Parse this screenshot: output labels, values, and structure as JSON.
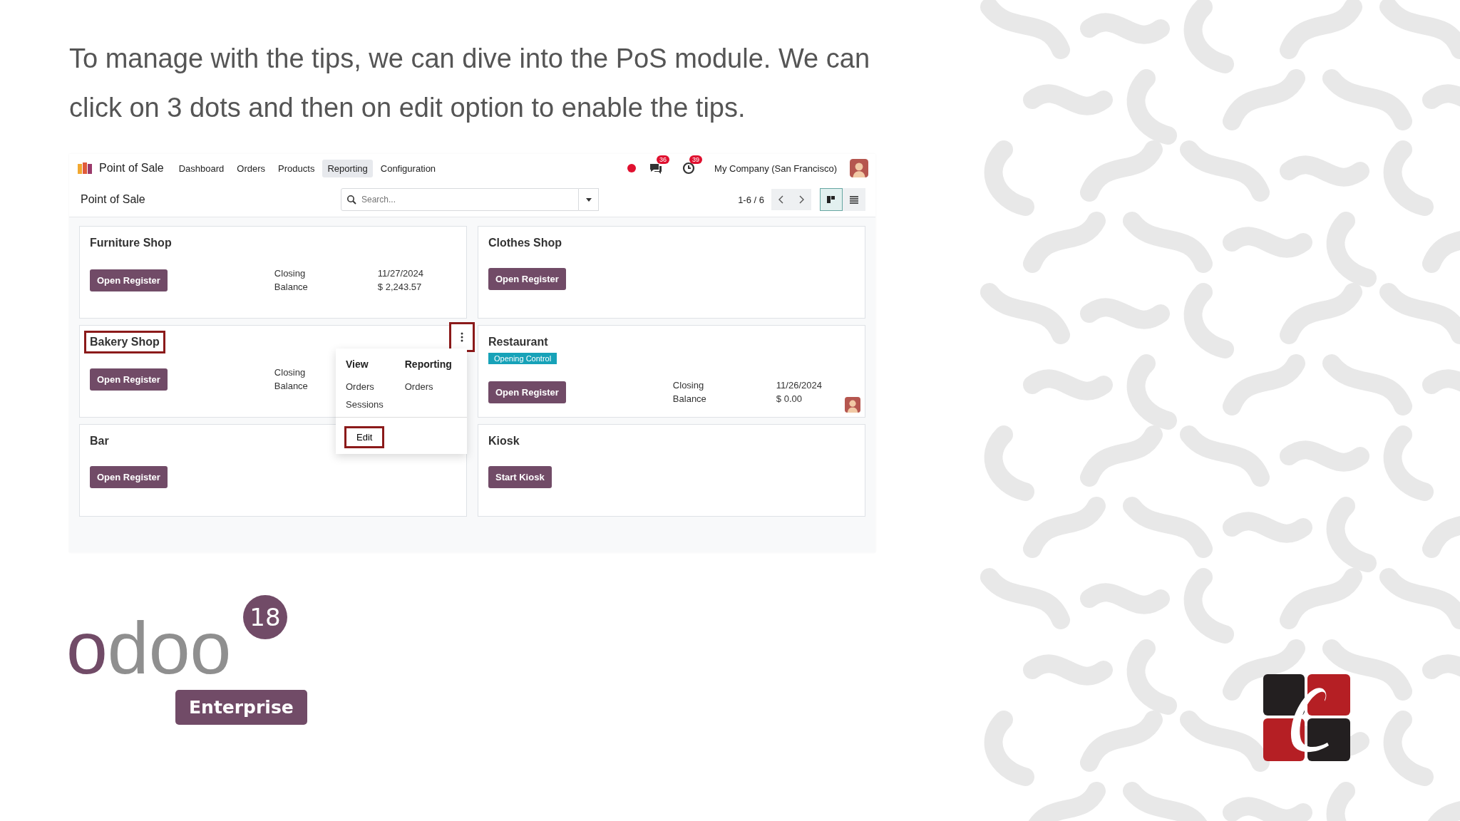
{
  "slide_text": "To manage with the tips, we can dive into the PoS module. We can click on 3 dots and then on edit option to enable the tips.",
  "app": {
    "navbar": {
      "app_name": "Point of Sale",
      "menu": [
        {
          "label": "Dashboard",
          "selected": false
        },
        {
          "label": "Orders",
          "selected": false
        },
        {
          "label": "Products",
          "selected": false
        },
        {
          "label": "Reporting",
          "selected": true
        },
        {
          "label": "Configuration",
          "selected": false
        }
      ],
      "chat_count": "36",
      "activity_count": "39",
      "company": "My Company (San Francisco)"
    },
    "control_panel": {
      "title": "Point of Sale",
      "search": {
        "placeholder": "Search..."
      },
      "pager": "1-6 / 6",
      "views": [
        {
          "kind": "kanban",
          "selected": true
        },
        {
          "kind": "list",
          "selected": false
        }
      ]
    },
    "cards": [
      {
        "name": "Furniture Shop",
        "button": "Open Register",
        "title_highlighted": false,
        "menu_open": false,
        "closing_label": "Closing",
        "balance_label": "Balance",
        "closing_date": "11/27/2024",
        "balance": "$ 2,243.57"
      },
      {
        "name": "Clothes Shop",
        "button": "Open Register",
        "title_highlighted": false,
        "menu_open": false
      },
      {
        "name": "Bakery Shop",
        "button": "Open Register",
        "title_highlighted": true,
        "menu_open": true,
        "closing_label": "Closing",
        "balance_label": "Balance"
      },
      {
        "name": "Restaurant",
        "tag": "Opening Control",
        "button": "Open Register",
        "title_highlighted": false,
        "menu_open": false,
        "closing_label": "Closing",
        "balance_label": "Balance",
        "closing_date": "11/26/2024",
        "balance": "$ 0.00",
        "has_user": true
      },
      {
        "name": "Bar",
        "button": "Open Register",
        "title_highlighted": false,
        "menu_open": false
      },
      {
        "name": "Kiosk",
        "button": "Start Kiosk",
        "title_highlighted": false,
        "menu_open": false
      }
    ],
    "dropdown": {
      "columns": [
        {
          "heading": "View",
          "items": [
            "Orders",
            "Sessions"
          ]
        },
        {
          "heading": "Reporting",
          "items": [
            "Orders"
          ]
        }
      ],
      "edit": "Edit",
      "edit_highlighted": true
    }
  },
  "logo": {
    "word": "odoo",
    "version": "18",
    "edition": "Enterprise"
  }
}
